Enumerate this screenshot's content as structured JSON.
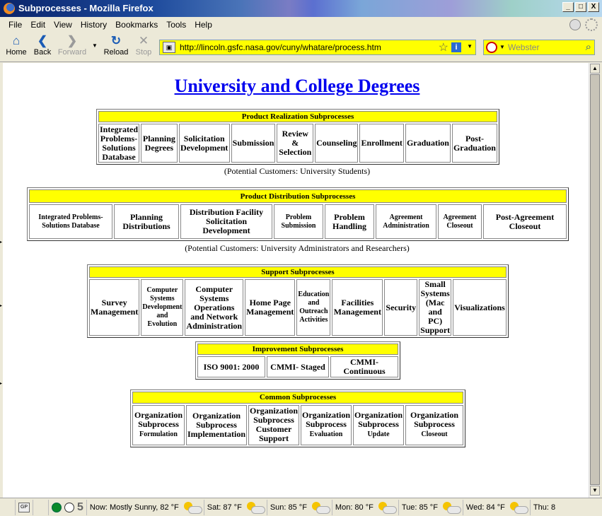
{
  "window": {
    "title": "Subprocesses - Mozilla Firefox",
    "controls": [
      "_",
      "□",
      "X"
    ]
  },
  "menu": [
    "File",
    "Edit",
    "View",
    "History",
    "Bookmarks",
    "Tools",
    "Help"
  ],
  "nav": {
    "home": "Home",
    "back": "Back",
    "forward": "Forward",
    "reload": "Reload",
    "stop": "Stop"
  },
  "address": {
    "url": "http://lincoln.gsfc.nasa.gov/cuny/whatare/process.htm"
  },
  "search": {
    "placeholder": "Webster"
  },
  "page": {
    "title": "University and College Degrees",
    "realization": {
      "header": "Product Realization Subprocesses",
      "cells": [
        "Integrated Problems-Solutions Database",
        "Planning Degrees",
        "Solicitation Development",
        "Submission",
        "Review & Selection",
        "Counseling",
        "Enrollment",
        "Graduation",
        "Post-Graduation"
      ],
      "caption": "(Potential Customers: University Students)"
    },
    "distribution": {
      "header": "Product Distribution Subprocesses",
      "cells": [
        "Integrated Problems-Solutions Database",
        "Planning Distributions",
        "Distribution Facility Solicitation Development",
        "Problem Submission",
        "Problem Handling",
        "Agreement Administration",
        "Agreement Closeout",
        "Post-Agreement Closeout"
      ],
      "caption": "(Potential Customers: University Administrators and Researchers)"
    },
    "support": {
      "header": "Support Subprocesses",
      "cells": [
        "Survey Management",
        "Computer Systems Development and Evolution",
        "Computer Systems Operations and Network Administration",
        "Home Page Management",
        "Education and Outreach Activities",
        "Facilities Management",
        "Security",
        "Small Systems (Mac and PC) Support",
        "Visualizations"
      ]
    },
    "improvement": {
      "header": "Improvement Subprocesses",
      "cells": [
        "ISO 9001: 2000",
        "CMMI- Staged",
        "CMMI-Continuous"
      ]
    },
    "common": {
      "header": "Common Subprocesses",
      "cells": [
        "Organization Subprocess Formulation",
        "Organization Subprocess Implementation",
        "Organization Subprocess Customer Support",
        "Organization Subprocess Evaluation",
        "Organization Subprocess Update",
        "Organization Subprocess Closeout"
      ]
    }
  },
  "status": {
    "gp": "GP",
    "count": "5",
    "forecast": [
      "Now: Mostly Sunny, 82 °F",
      "Sat: 87 °F",
      "Sun: 85 °F",
      "Mon: 80 °F",
      "Tue: 85 °F",
      "Wed: 84 °F",
      "Thu: 8"
    ]
  }
}
